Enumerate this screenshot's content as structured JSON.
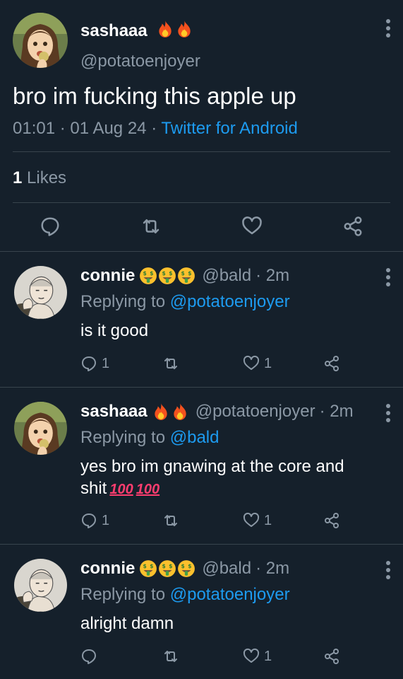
{
  "main_tweet": {
    "author_name": "sashaaa",
    "author_emoji": [
      "fire-icon",
      "fire-icon"
    ],
    "handle": "@potatoenjoyer",
    "text": "bro im fucking this apple up",
    "time": "01:01",
    "date": "01 Aug 24",
    "source": "Twitter for Android",
    "likes_count": "1",
    "likes_label": "Likes"
  },
  "replies": [
    {
      "author_name": "connie",
      "author_emoji": [
        "money-mouth-face-icon",
        "money-mouth-face-icon",
        "money-mouth-face-icon"
      ],
      "handle": "@bald",
      "age": "· 2m",
      "replying_prefix": "Replying to",
      "replying_to": "@potatoenjoyer",
      "text": "is it good",
      "reply_count": "1",
      "like_count": "1"
    },
    {
      "author_name": "sashaaa",
      "author_emoji": [
        "fire-icon",
        "fire-icon"
      ],
      "handle": "@potatoenjoyer",
      "age": "· 2m",
      "replying_prefix": "Replying to",
      "replying_to": "@bald",
      "text_line1": "yes bro im gnawing at the core and",
      "text_line2": "shit",
      "text_emoji": [
        "hundred-points-icon",
        "hundred-points-icon"
      ],
      "hundred_text": "100",
      "reply_count": "1",
      "like_count": "1"
    },
    {
      "author_name": "connie",
      "author_emoji": [
        "money-mouth-face-icon",
        "money-mouth-face-icon",
        "money-mouth-face-icon"
      ],
      "handle": "@bald",
      "age": "· 2m",
      "replying_prefix": "Replying to",
      "replying_to": "@potatoenjoyer",
      "text": "alright damn",
      "reply_count": "",
      "like_count": "1"
    }
  ],
  "colors": {
    "background": "#15202b",
    "divider": "#38444d",
    "muted": "#8b98a5",
    "link": "#1d9bf0",
    "text": "#ffffff"
  }
}
